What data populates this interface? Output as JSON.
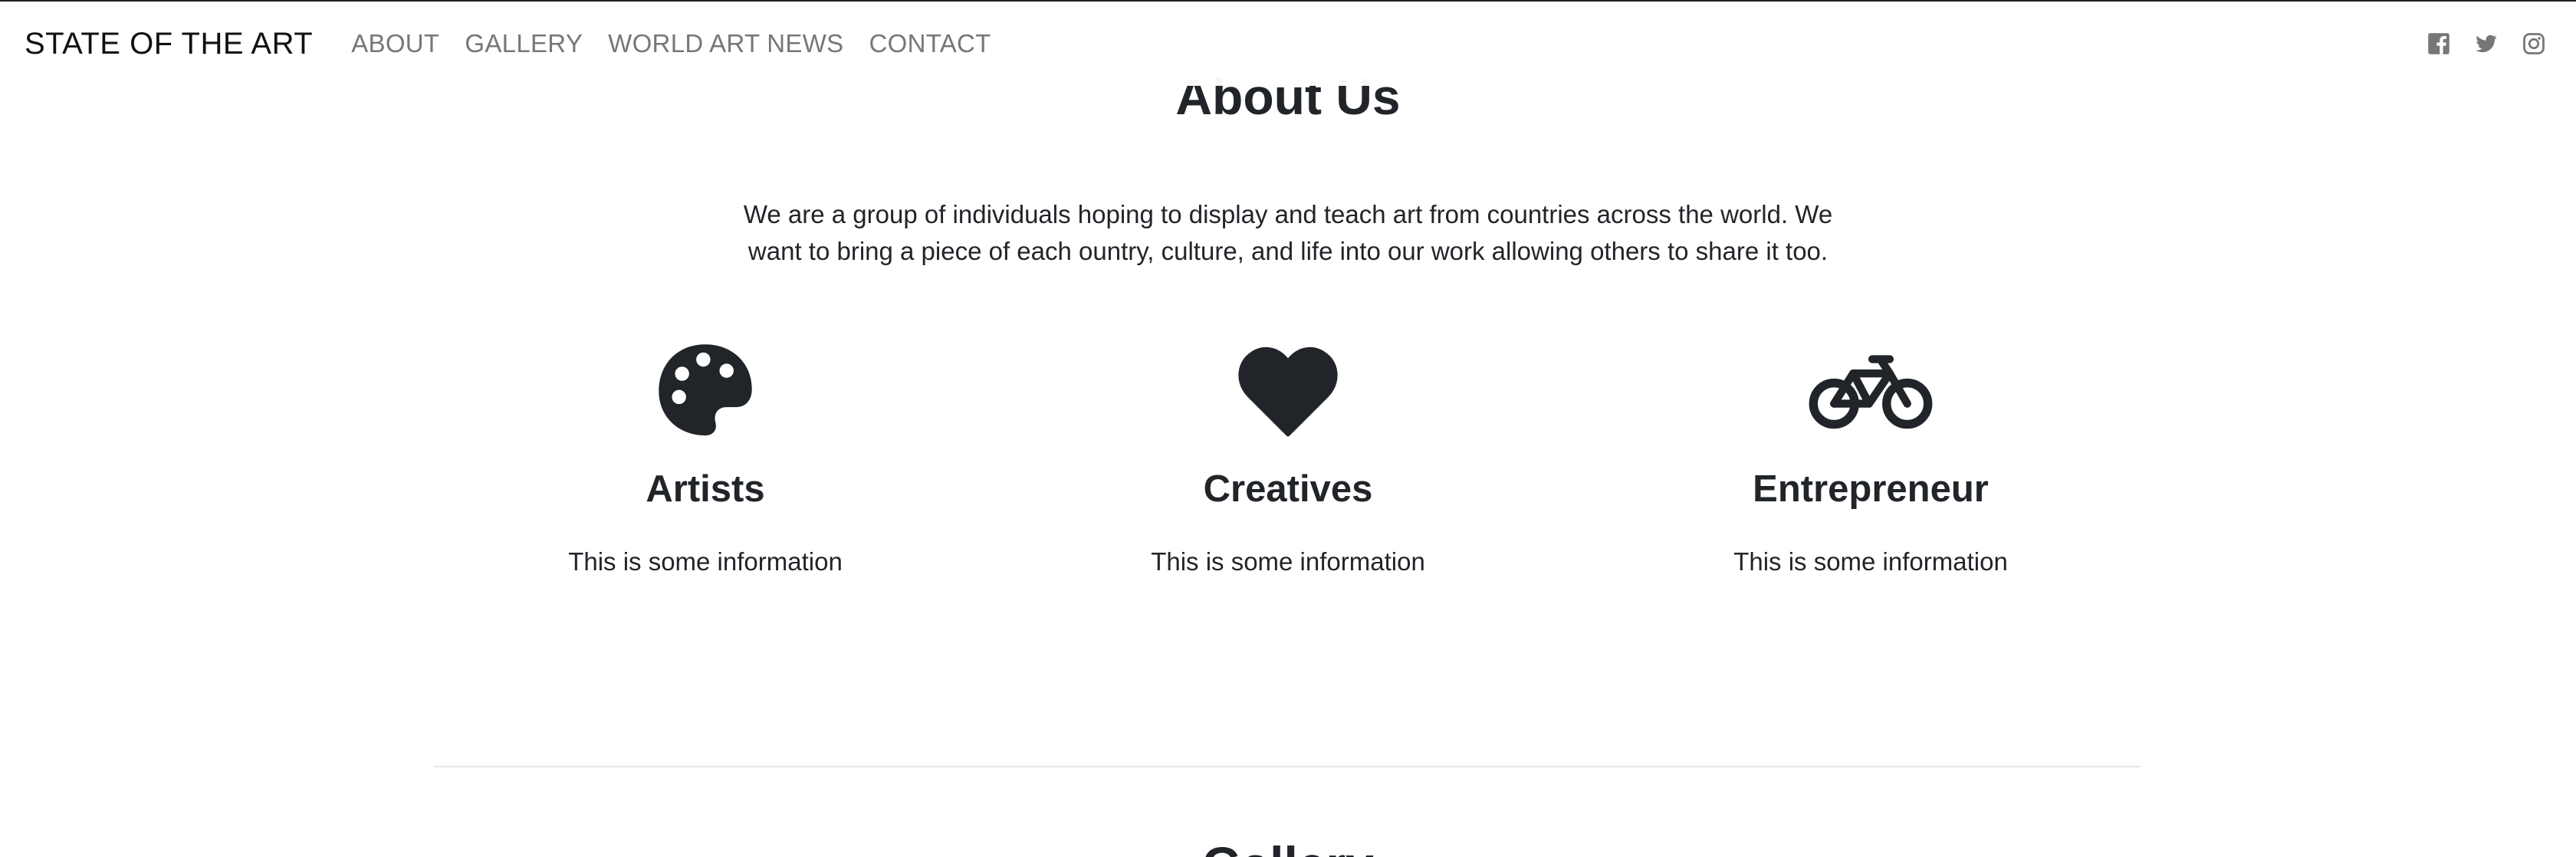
{
  "navbar": {
    "brand": "STATE OF THE ART",
    "links": [
      "ABOUT",
      "GALLERY",
      "WORLD ART NEWS",
      "CONTACT"
    ],
    "social": [
      "facebook-icon",
      "twitter-icon",
      "instagram-icon"
    ]
  },
  "about": {
    "title": "About Us",
    "text": "We are a group of individuals hoping to display and teach art from countries across the world. We want to bring a piece of each ountry, culture, and life into our work allowing others to share it too."
  },
  "features": [
    {
      "icon": "palette-icon",
      "title": "Artists",
      "text": "This is some information"
    },
    {
      "icon": "heart-icon",
      "title": "Creatives",
      "text": "This is some information"
    },
    {
      "icon": "bicycle-icon",
      "title": "Entrepreneur",
      "text": "This is some information"
    }
  ],
  "gallery": {
    "title": "Gallery"
  },
  "colors": {
    "text": "#212529",
    "nav_link": "#777777",
    "divider": "#e6e6e6"
  }
}
